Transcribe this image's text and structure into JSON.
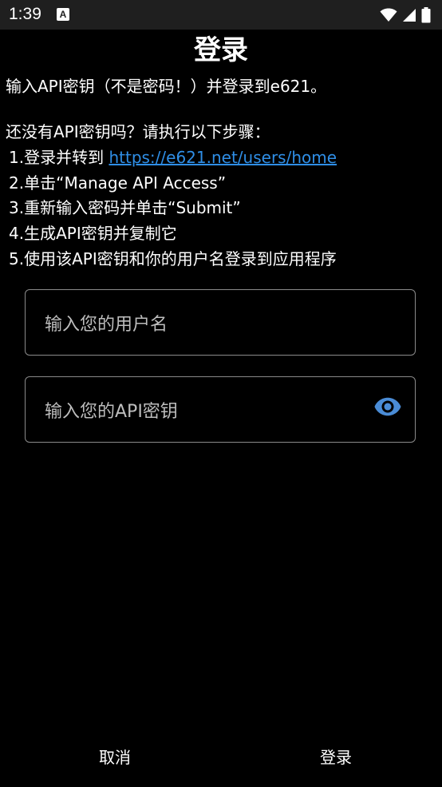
{
  "status_bar": {
    "time": "1:39",
    "notification_icon_letter": "A",
    "icons": [
      "wifi-icon",
      "cell-signal-icon",
      "battery-icon"
    ],
    "background": "#1f1f1f"
  },
  "title": "登录",
  "intro": "输入API密钥（不是密码！）并登录到e621。",
  "steps_header": "还没有API密钥吗？请执行以下步骤：",
  "steps": [
    {
      "prefix": "1.登录并转到 ",
      "link": "https://e621.net/users/home"
    },
    {
      "text": "2.单击“Manage API Access”"
    },
    {
      "text": "3.重新输入密码并单击“Submit”"
    },
    {
      "text": "4.生成API密钥并复制它"
    },
    {
      "text": "5.使用该API密钥和你的用户名登录到应用程序"
    }
  ],
  "username_field": {
    "value": "",
    "placeholder": "输入您的用户名"
  },
  "apikey_field": {
    "value": "",
    "placeholder": "输入您的API密钥",
    "icon": "eye-icon"
  },
  "footer": {
    "cancel_label": "取消",
    "login_label": "登录"
  },
  "colors": {
    "background": "#000000",
    "link": "#2f8ee6",
    "accent_icon": "#4a8cd6",
    "field_border": "#8a8a8a"
  }
}
